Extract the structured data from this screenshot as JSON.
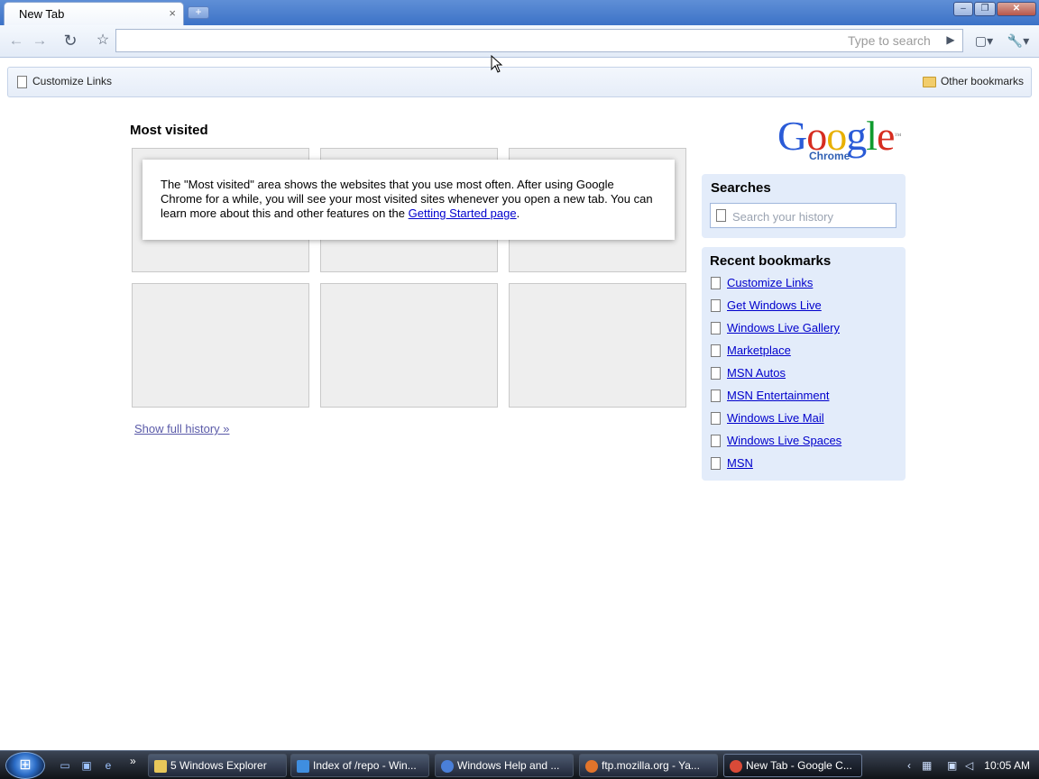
{
  "tab": {
    "title": "New Tab",
    "close": "×",
    "new_tab": "+"
  },
  "window": {
    "min": "–",
    "max": "❐",
    "close": "✕"
  },
  "toolbar": {
    "back": "←",
    "forward": "→",
    "reload": "↻",
    "star": "☆",
    "omnibox_value": "",
    "omnibox_placeholder": "Type to search",
    "go": "▶",
    "page_menu": "▢▾",
    "wrench_menu": "🔧▾"
  },
  "bookmark_bar": {
    "customize": "Customize Links",
    "other": "Other bookmarks"
  },
  "most_visited": {
    "title": "Most visited",
    "info_text": "The \"Most visited\" area shows the websites that you use most often. After using Google Chrome for a while, you will see your most visited sites whenever you open a new tab. You can learn more about this and other features on the ",
    "info_link": "Getting Started page",
    "info_end": ".",
    "show_history": "Show full history »"
  },
  "logo": {
    "g1": "G",
    "o1": "o",
    "o2": "o",
    "g2": "g",
    "l": "l",
    "e": "e",
    "sub": "Chrome",
    "tm": "™"
  },
  "searches": {
    "title": "Searches",
    "placeholder": "Search your history"
  },
  "recent_bookmarks": {
    "title": "Recent bookmarks",
    "items": [
      "Customize Links",
      "Get Windows Live",
      "Windows Live Gallery",
      "Marketplace",
      "MSN Autos",
      "MSN Entertainment",
      "Windows Live Mail",
      "Windows Live Spaces",
      "MSN"
    ]
  },
  "taskbar": {
    "start": "⊞",
    "more": "»",
    "tasks": [
      {
        "label": "5 Windows Explorer",
        "icon_color": "#e8c75a"
      },
      {
        "label": "Index of /repo - Win...",
        "icon_color": "#3f8ee0"
      },
      {
        "label": "Windows Help and ...",
        "icon_color": "#4a7fd8"
      },
      {
        "label": "ftp.mozilla.org - Ya...",
        "icon_color": "#e2742b"
      },
      {
        "label": "New Tab - Google C...",
        "icon_color": "#d94a38"
      }
    ],
    "time": "10:05 AM"
  }
}
